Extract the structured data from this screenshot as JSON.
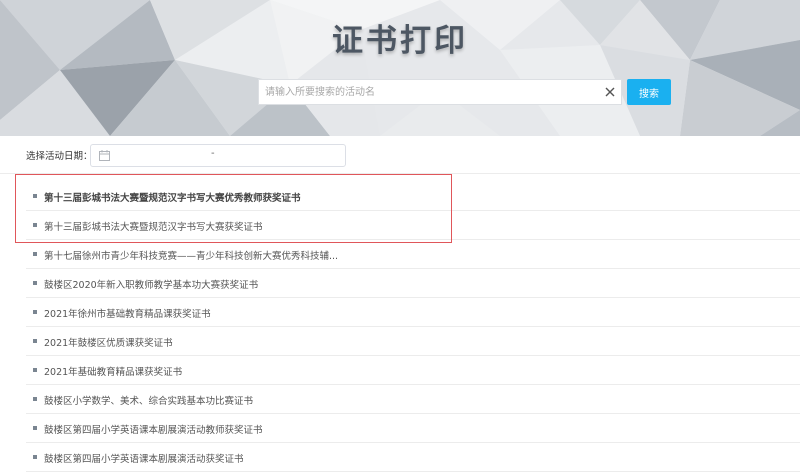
{
  "header": {
    "title": "证书打印"
  },
  "search": {
    "placeholder": "请输入所要搜索的活动名",
    "button_label": "搜索"
  },
  "date_filter": {
    "label": "选择活动日期：",
    "separator": "-",
    "icon": "calendar-icon"
  },
  "certificates": [
    "第十三届彭城书法大赛暨规范汉字书写大赛优秀教师获奖证书",
    "第十三届彭城书法大赛暨规范汉字书写大赛获奖证书",
    "第十七届徐州市青少年科技竞赛——青少年科技创新大赛优秀科技辅...",
    "鼓楼区2020年新入职教师教学基本功大赛获奖证书",
    "2021年徐州市基础教育精品课获奖证书",
    "2021年鼓楼区优质课获奖证书",
    "2021年基础教育精品课获奖证书",
    "鼓楼区小学数学、美术、综合实践基本功比赛证书",
    "鼓楼区第四届小学英语课本剧展演活动教师获奖证书",
    "鼓楼区第四届小学英语课本剧展演活动获奖证书"
  ],
  "colors": {
    "search_button": "#1ab0f0",
    "highlight_border": "#e0565a",
    "title": "#4d5763"
  }
}
